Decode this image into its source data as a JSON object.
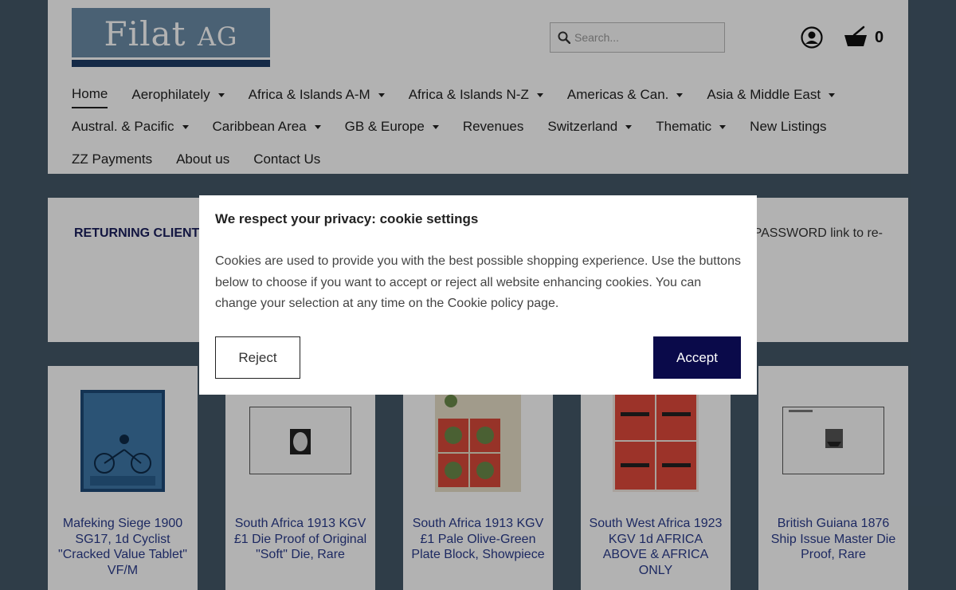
{
  "logo": {
    "text_main": "Filat",
    "text_small": "AG"
  },
  "search": {
    "placeholder": "Search..."
  },
  "cart": {
    "count": "0"
  },
  "nav": {
    "row1": [
      {
        "label": "Home",
        "dropdown": false,
        "active": true
      },
      {
        "label": "Aerophilately",
        "dropdown": true
      },
      {
        "label": "Africa & Islands A-M",
        "dropdown": true
      },
      {
        "label": "Africa & Islands N-Z",
        "dropdown": true
      },
      {
        "label": "Americas & Can.",
        "dropdown": true
      },
      {
        "label": "Asia & Middle East",
        "dropdown": true
      }
    ],
    "row2": [
      {
        "label": "Austral. & Pacific",
        "dropdown": true
      },
      {
        "label": "Caribbean Area",
        "dropdown": true
      },
      {
        "label": "GB & Europe",
        "dropdown": true
      },
      {
        "label": "Revenues",
        "dropdown": false
      },
      {
        "label": "Switzerland",
        "dropdown": true
      },
      {
        "label": "Thematic",
        "dropdown": true
      },
      {
        "label": "New Listings",
        "dropdown": false
      }
    ],
    "row3": [
      {
        "label": "ZZ Payments",
        "dropdown": false
      },
      {
        "label": "About us",
        "dropdown": false
      },
      {
        "label": "Contact Us",
        "dropdown": false
      }
    ]
  },
  "login_panel": {
    "returning_label": "RETURNING CLIENT",
    "password_text": "PASSWORD link to re-"
  },
  "products": [
    {
      "title": "Mafeking Siege 1900 SG17, 1d Cyclist \"Cracked Value Tablet\" VF/M"
    },
    {
      "title": "South Africa 1913 KGV £1 Die Proof of Original \"Soft\" Die, Rare"
    },
    {
      "title": "South Africa 1913 KGV £1 Pale Olive-Green Plate Block, Showpiece"
    },
    {
      "title": "South West Africa 1923 KGV 1d AFRICA ABOVE & AFRICA ONLY"
    },
    {
      "title": "British Guiana 1876 Ship Issue Master Die Proof, Rare"
    }
  ],
  "cookie_modal": {
    "title": "We respect your privacy: cookie settings",
    "body": "Cookies are used to provide you with the best possible shopping experience. Use the buttons below to choose if you want to accept or reject all website enhancing cookies. You can change your selection at any time on the Cookie policy page.",
    "reject_label": "Reject",
    "accept_label": "Accept"
  },
  "colors": {
    "background": "#445868",
    "accent_dark": "#0a0a4a",
    "logo_blue": "#6b8ba6"
  }
}
